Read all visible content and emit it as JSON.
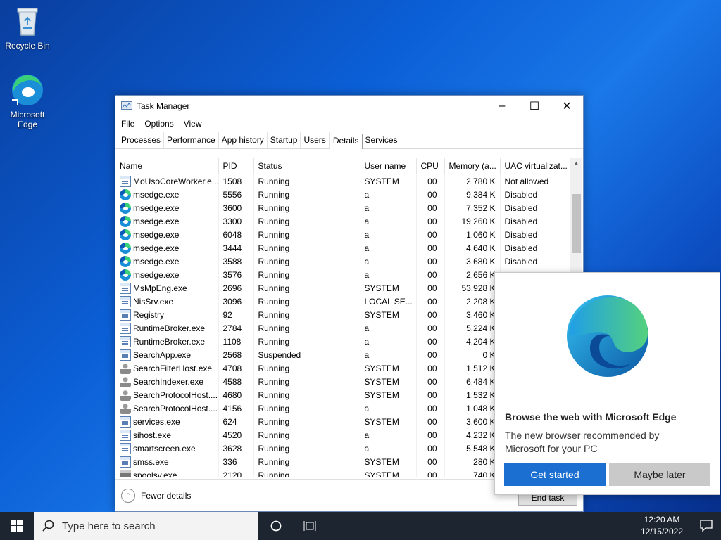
{
  "desktop": {
    "recycle_bin_label": "Recycle Bin",
    "edge_label_1": "Microsoft",
    "edge_label_2": "Edge"
  },
  "task_manager": {
    "title": "Task Manager",
    "menu": [
      "File",
      "Options",
      "View"
    ],
    "tabs": [
      "Processes",
      "Performance",
      "App history",
      "Startup",
      "Users",
      "Details",
      "Services"
    ],
    "active_tab": "Details",
    "columns": [
      "Name",
      "PID",
      "Status",
      "User name",
      "CPU",
      "Memory (a...",
      "UAC virtualizat..."
    ],
    "rows": [
      {
        "icon": "win",
        "name": "MoUsoCoreWorker.e...",
        "pid": "1508",
        "status": "Running",
        "user": "SYSTEM",
        "cpu": "00",
        "mem": "2,780 K",
        "uac": "Not allowed"
      },
      {
        "icon": "edge",
        "name": "msedge.exe",
        "pid": "5556",
        "status": "Running",
        "user": "a",
        "cpu": "00",
        "mem": "9,384 K",
        "uac": "Disabled"
      },
      {
        "icon": "edge",
        "name": "msedge.exe",
        "pid": "3600",
        "status": "Running",
        "user": "a",
        "cpu": "00",
        "mem": "7,352 K",
        "uac": "Disabled"
      },
      {
        "icon": "edge",
        "name": "msedge.exe",
        "pid": "3300",
        "status": "Running",
        "user": "a",
        "cpu": "00",
        "mem": "19,260 K",
        "uac": "Disabled"
      },
      {
        "icon": "edge",
        "name": "msedge.exe",
        "pid": "6048",
        "status": "Running",
        "user": "a",
        "cpu": "00",
        "mem": "1,060 K",
        "uac": "Disabled"
      },
      {
        "icon": "edge",
        "name": "msedge.exe",
        "pid": "3444",
        "status": "Running",
        "user": "a",
        "cpu": "00",
        "mem": "4,640 K",
        "uac": "Disabled"
      },
      {
        "icon": "edge",
        "name": "msedge.exe",
        "pid": "3588",
        "status": "Running",
        "user": "a",
        "cpu": "00",
        "mem": "3,680 K",
        "uac": "Disabled"
      },
      {
        "icon": "edge",
        "name": "msedge.exe",
        "pid": "3576",
        "status": "Running",
        "user": "a",
        "cpu": "00",
        "mem": "2,656 K",
        "uac": ""
      },
      {
        "icon": "win",
        "name": "MsMpEng.exe",
        "pid": "2696",
        "status": "Running",
        "user": "SYSTEM",
        "cpu": "00",
        "mem": "53,928 K",
        "uac": ""
      },
      {
        "icon": "win",
        "name": "NisSrv.exe",
        "pid": "3096",
        "status": "Running",
        "user": "LOCAL SE...",
        "cpu": "00",
        "mem": "2,208 K",
        "uac": ""
      },
      {
        "icon": "win",
        "name": "Registry",
        "pid": "92",
        "status": "Running",
        "user": "SYSTEM",
        "cpu": "00",
        "mem": "3,460 K",
        "uac": ""
      },
      {
        "icon": "win",
        "name": "RuntimeBroker.exe",
        "pid": "2784",
        "status": "Running",
        "user": "a",
        "cpu": "00",
        "mem": "5,224 K",
        "uac": ""
      },
      {
        "icon": "win",
        "name": "RuntimeBroker.exe",
        "pid": "1108",
        "status": "Running",
        "user": "a",
        "cpu": "00",
        "mem": "4,204 K",
        "uac": ""
      },
      {
        "icon": "win",
        "name": "SearchApp.exe",
        "pid": "2568",
        "status": "Suspended",
        "user": "a",
        "cpu": "00",
        "mem": "0 K",
        "uac": ""
      },
      {
        "icon": "user",
        "name": "SearchFilterHost.exe",
        "pid": "4708",
        "status": "Running",
        "user": "SYSTEM",
        "cpu": "00",
        "mem": "1,512 K",
        "uac": ""
      },
      {
        "icon": "user",
        "name": "SearchIndexer.exe",
        "pid": "4588",
        "status": "Running",
        "user": "SYSTEM",
        "cpu": "00",
        "mem": "6,484 K",
        "uac": ""
      },
      {
        "icon": "user",
        "name": "SearchProtocolHost....",
        "pid": "4680",
        "status": "Running",
        "user": "SYSTEM",
        "cpu": "00",
        "mem": "1,532 K",
        "uac": ""
      },
      {
        "icon": "user",
        "name": "SearchProtocolHost....",
        "pid": "4156",
        "status": "Running",
        "user": "a",
        "cpu": "00",
        "mem": "1,048 K",
        "uac": ""
      },
      {
        "icon": "win",
        "name": "services.exe",
        "pid": "624",
        "status": "Running",
        "user": "SYSTEM",
        "cpu": "00",
        "mem": "3,600 K",
        "uac": ""
      },
      {
        "icon": "win",
        "name": "sihost.exe",
        "pid": "4520",
        "status": "Running",
        "user": "a",
        "cpu": "00",
        "mem": "4,232 K",
        "uac": ""
      },
      {
        "icon": "win",
        "name": "smartscreen.exe",
        "pid": "3628",
        "status": "Running",
        "user": "a",
        "cpu": "00",
        "mem": "5,548 K",
        "uac": ""
      },
      {
        "icon": "win",
        "name": "smss.exe",
        "pid": "336",
        "status": "Running",
        "user": "SYSTEM",
        "cpu": "00",
        "mem": "280 K",
        "uac": ""
      },
      {
        "icon": "printer",
        "name": "spoolsv.exe",
        "pid": "2120",
        "status": "Running",
        "user": "SYSTEM",
        "cpu": "00",
        "mem": "740 K",
        "uac": ""
      }
    ],
    "fewer_details": "Fewer details",
    "end_task": "End task"
  },
  "edge_popup": {
    "heading": "Browse the web with Microsoft Edge",
    "body": "The new browser recommended by Microsoft for your PC",
    "primary_button": "Get started",
    "secondary_button": "Maybe later"
  },
  "taskbar": {
    "search_placeholder": "Type here to search",
    "time": "12:20 AM",
    "date": "12/15/2022"
  },
  "colors": {
    "accent": "#1a6fd1",
    "taskbar": "#1c2530"
  }
}
